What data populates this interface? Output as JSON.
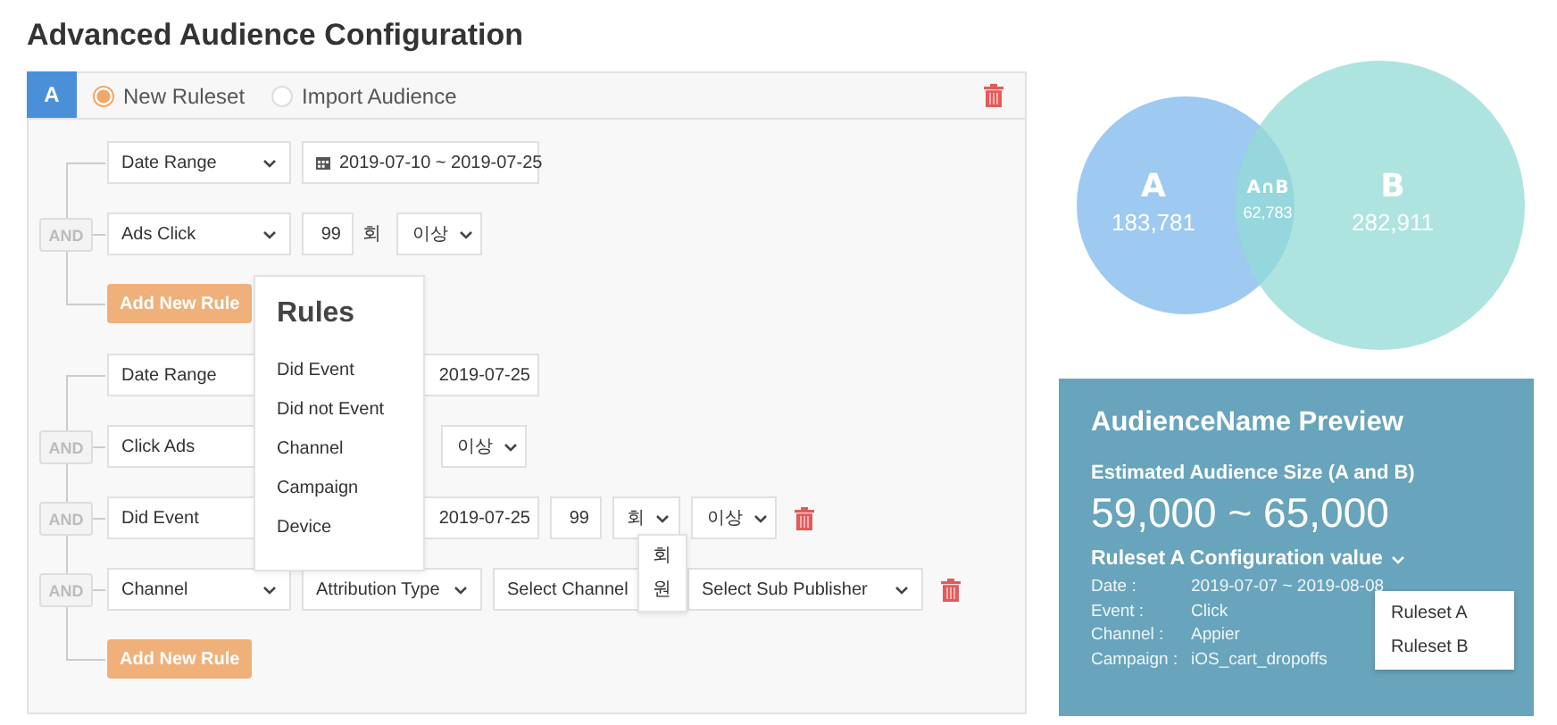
{
  "title": "Advanced Audience Configuration",
  "ruleset": {
    "tab": "A",
    "options": [
      {
        "label": "New Ruleset",
        "selected": true
      },
      {
        "label": "Import Audience",
        "selected": false
      }
    ],
    "groups": [
      {
        "rules": [
          {
            "removable": false,
            "fields": [
              {
                "kind": "event",
                "text": "Date Range"
              },
              {
                "kind": "date",
                "text": "2019-07-10 ~ 2019-07-25"
              }
            ]
          },
          {
            "connector": "AND",
            "removable": false,
            "fields": [
              {
                "kind": "event",
                "text": "Ads Click"
              },
              {
                "kind": "count",
                "text": "99"
              },
              {
                "kind": "unit",
                "text": "회"
              },
              {
                "kind": "op",
                "text": "이상"
              }
            ]
          }
        ],
        "add_button": "Add New Rule"
      },
      {
        "rules": [
          {
            "removable": false,
            "fields": [
              {
                "kind": "event",
                "text": "Date Range"
              },
              {
                "kind": "date",
                "text": "2019-07-25"
              }
            ]
          },
          {
            "connector": "AND",
            "removable": false,
            "fields": [
              {
                "kind": "event",
                "text": "Click Ads"
              },
              {
                "kind": "op",
                "text": "이상"
              }
            ]
          },
          {
            "connector": "AND",
            "removable": true,
            "fields": [
              {
                "kind": "event",
                "text": "Did Event"
              },
              {
                "kind": "date",
                "text": "2019-07-25"
              },
              {
                "kind": "count",
                "text": "99"
              },
              {
                "kind": "unit_select",
                "text": "회"
              },
              {
                "kind": "op",
                "text": "이상"
              }
            ]
          },
          {
            "connector": "AND",
            "removable": true,
            "fields": [
              {
                "kind": "event",
                "text": "Channel"
              },
              {
                "kind": "attr",
                "text": "Attribution Type"
              },
              {
                "kind": "channel",
                "text": "Select Channel"
              },
              {
                "kind": "sub",
                "text": "Select Sub Publisher"
              }
            ]
          }
        ],
        "add_button": "Add New Rule"
      }
    ],
    "rules_menu": {
      "title": "Rules",
      "items": [
        "Did Event",
        "Did not Event",
        "Channel",
        "Campaign",
        "Device"
      ]
    },
    "unit_menu": {
      "items": [
        "회",
        "원"
      ]
    }
  },
  "venn": {
    "sets": [
      {
        "label": "A",
        "value": "183,781"
      },
      {
        "label": "B",
        "value": "282,911"
      }
    ],
    "intersection": {
      "label": "A∩B",
      "value": "62,783"
    }
  },
  "preview": {
    "title": "AudienceName Preview",
    "size_label": "Estimated Audience Size (A and B)",
    "size_value": "59,000 ~ 65,000",
    "config_label": "Ruleset A Configuration value",
    "details": [
      {
        "label": "Date :",
        "value": "2019-07-07 ~ 2019-08-08"
      },
      {
        "label": "Event :",
        "value": "Click"
      },
      {
        "label": "Channel :",
        "value": "Appier"
      },
      {
        "label": "Campaign :",
        "value": "iOS_cart_dropoffs"
      }
    ],
    "ruleset_menu": [
      "Ruleset A",
      "Ruleset B"
    ]
  }
}
